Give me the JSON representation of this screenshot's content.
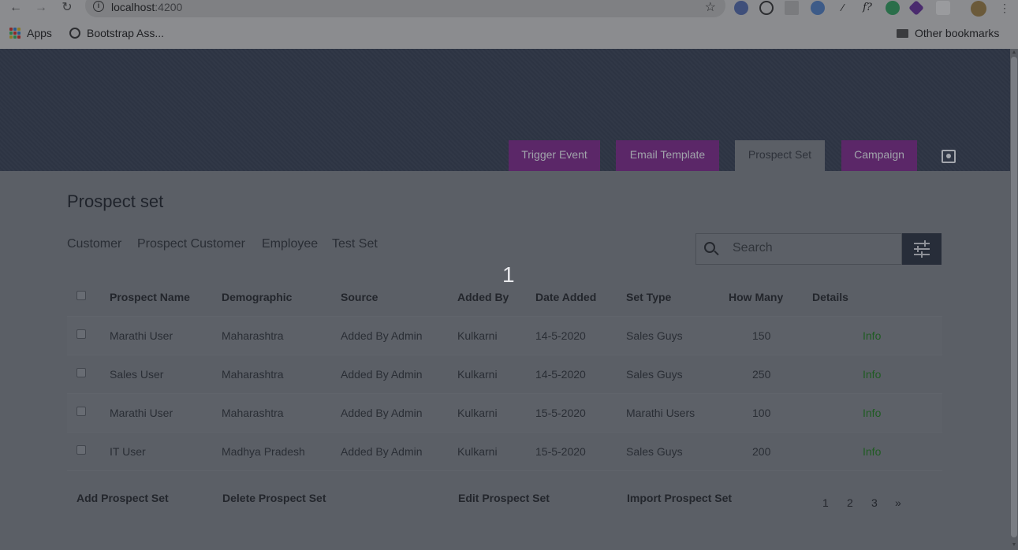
{
  "browser": {
    "url_host": "localhost",
    "url_port": ":4200",
    "bookmarks": [
      {
        "label": "Apps"
      },
      {
        "label": "Bootstrap Ass..."
      }
    ],
    "other_bookmarks": "Other bookmarks"
  },
  "header": {
    "tabs": [
      {
        "label": "Trigger Event",
        "style": "purple"
      },
      {
        "label": "Email Template",
        "style": "purple"
      },
      {
        "label": "Prospect Set",
        "style": "active"
      },
      {
        "label": "Campaign",
        "style": "purple"
      }
    ]
  },
  "main": {
    "title": "Prospect set",
    "filter_tabs": [
      "Customer",
      "Prospect Customer",
      "Employee",
      "Test Set"
    ],
    "search": {
      "placeholder": "Search"
    },
    "step_badge": "1",
    "table": {
      "columns": [
        "Prospect Name",
        "Demographic",
        "Source",
        "Added By",
        "Date Added",
        "Set Type",
        "How Many",
        "Details"
      ],
      "rows": [
        [
          "Marathi User",
          "Maharashtra",
          "Added By Admin",
          "Kulkarni",
          "14-5-2020",
          "Sales Guys",
          "150",
          "Info"
        ],
        [
          "Sales User",
          "Maharashtra",
          "Added By Admin",
          "Kulkarni",
          "14-5-2020",
          "Sales Guys",
          "250",
          "Info"
        ],
        [
          "Marathi User",
          "Maharashtra",
          "Added By Admin",
          "Kulkarni",
          "15-5-2020",
          "Marathi Users",
          "100",
          "Info"
        ],
        [
          "IT User",
          "Madhya Pradesh",
          "Added By Admin",
          "Kulkarni",
          "15-5-2020",
          "Sales Guys",
          "200",
          "Info"
        ]
      ]
    },
    "actions": {
      "add": "Add Prospect Set",
      "delete": "Delete Prospect Set",
      "edit": "Edit Prospect Set",
      "import": "Import Prospect Set"
    },
    "pagination": [
      "1",
      "2",
      "3",
      "»"
    ]
  },
  "colors": {
    "header_bg": "#2d3443",
    "tab_purple": "#5b2768",
    "info_link": "#1f5b22"
  }
}
